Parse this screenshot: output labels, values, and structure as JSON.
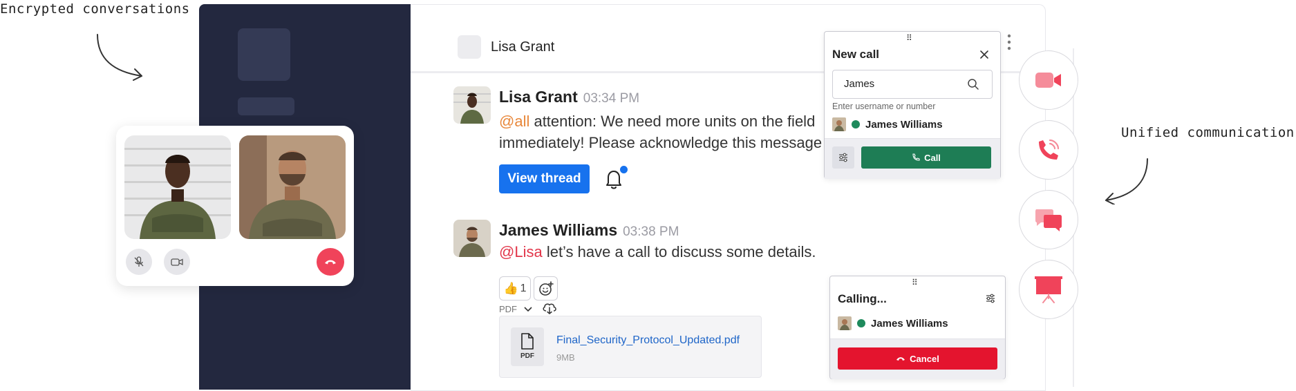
{
  "annotations": {
    "left": "Encrypted conversations",
    "right": "Unified communication"
  },
  "chat": {
    "header": {
      "contact_name": "Lisa Grant"
    },
    "messages": [
      {
        "author": "Lisa Grant",
        "time": "03:34 PM",
        "mention": "@all",
        "text_line1": " attention: We need more units on the field",
        "text_line2": "immediately! Please acknowledge this message",
        "thread_button": "View thread"
      },
      {
        "author": "James Williams",
        "time": "03:38 PM",
        "mention": "@Lisa",
        "text": " let’s have a call to discuss some details.",
        "reactions": [
          {
            "emoji": "👍",
            "count": "1"
          }
        ],
        "attachment": {
          "format_label": "PDF",
          "icon_label": "PDF",
          "file_name": "Final_Security_Protocol_Updated.pdf",
          "file_size": "9MB"
        }
      }
    ]
  },
  "new_call": {
    "title": "New call",
    "search_value": "James",
    "hint": "Enter username or number",
    "result_name": "James Williams",
    "call_label": "Call"
  },
  "calling": {
    "title": "Calling...",
    "person": "James Williams",
    "cancel_label": "Cancel"
  },
  "rail": {
    "items": [
      "video-icon",
      "phone-call-icon",
      "chat-bubbles-icon",
      "presentation-icon"
    ],
    "accent": "#f0435a"
  },
  "colors": {
    "sidebar": "#23283f",
    "primary_blue": "#1772ee",
    "call_green": "#1e7d55",
    "cancel_red": "#e4142e",
    "online": "#1e8a5c"
  }
}
